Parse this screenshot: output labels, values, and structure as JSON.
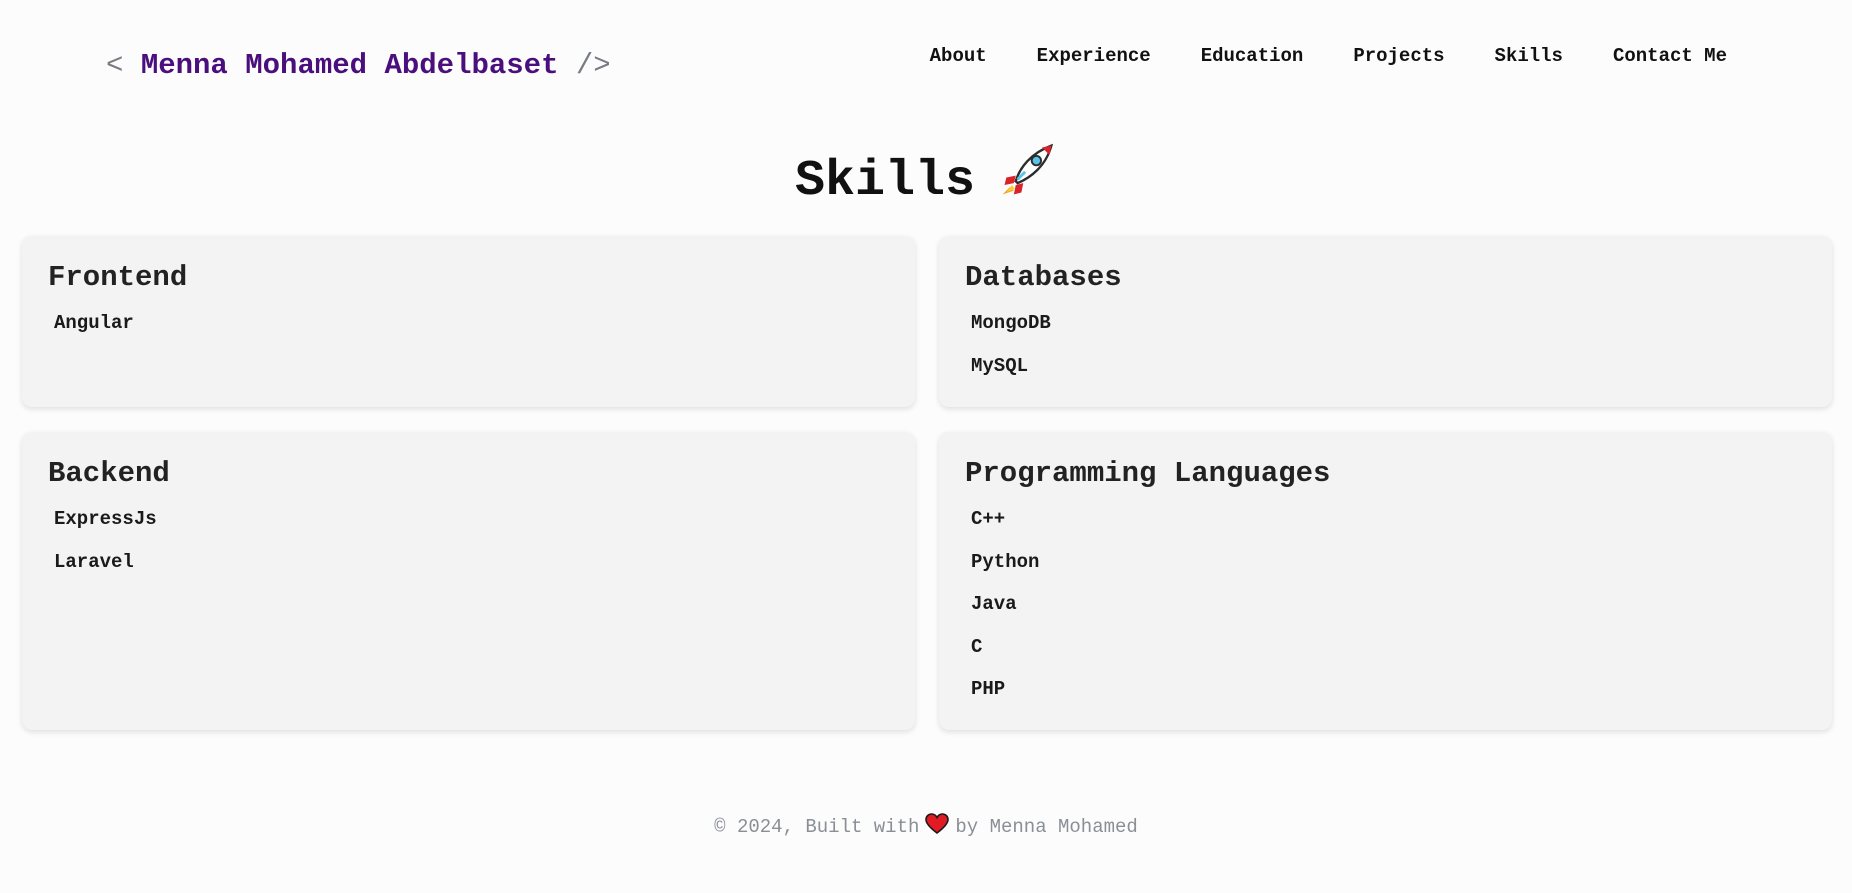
{
  "header": {
    "logo_open": "<",
    "logo_name": "Menna Mohamed Abdelbaset",
    "logo_close": "/>",
    "nav": [
      {
        "label": "About"
      },
      {
        "label": "Experience"
      },
      {
        "label": "Education"
      },
      {
        "label": "Projects"
      },
      {
        "label": "Skills"
      },
      {
        "label": "Contact Me"
      }
    ]
  },
  "page": {
    "title": "Skills",
    "title_icon": "rocket-icon"
  },
  "skills": {
    "frontend": {
      "title": "Frontend",
      "items": [
        "Angular"
      ]
    },
    "databases": {
      "title": "Databases",
      "items": [
        "MongoDB",
        "MySQL"
      ]
    },
    "backend": {
      "title": "Backend",
      "items": [
        "ExpressJs",
        "Laravel"
      ]
    },
    "languages": {
      "title": "Programming Languages",
      "items": [
        "C++",
        "Python",
        "Java",
        "C",
        "PHP"
      ]
    }
  },
  "footer": {
    "prefix": "© 2024, Built with",
    "icon": "heart-icon",
    "suffix": "by Menna Mohamed"
  },
  "colors": {
    "logo_name": "#4b0f7d",
    "logo_bracket": "#777b82",
    "card_bg": "#f3f3f3",
    "footer_text": "#8a8f96"
  }
}
